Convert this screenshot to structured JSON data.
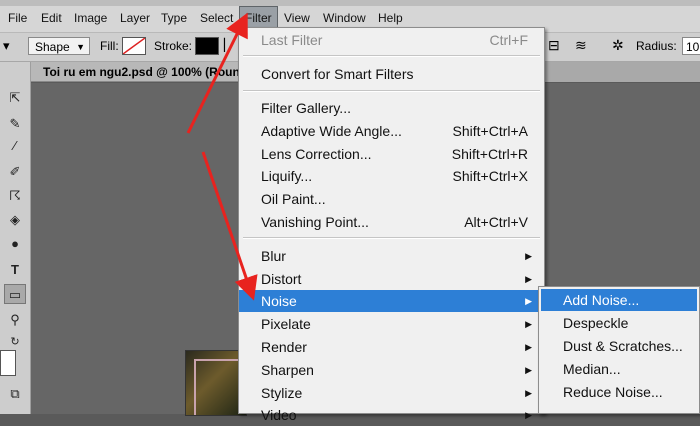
{
  "menubar": {
    "items": [
      "File",
      "Edit",
      "Image",
      "Layer",
      "Type",
      "Select",
      "Filter",
      "View",
      "Window",
      "Help"
    ],
    "active": "Filter"
  },
  "options": {
    "shape_mode": "Shape",
    "fill_label": "Fill:",
    "stroke_label": "Stroke:",
    "radius_label": "Radius:",
    "radius_value": "10"
  },
  "document": {
    "tab_title": "Toi ru em ngu2.psd @ 100% (Roun"
  },
  "filter_menu": {
    "last_filter": {
      "label": "Last Filter",
      "shortcut": "Ctrl+F"
    },
    "convert": "Convert for Smart Filters",
    "group1": [
      {
        "label": "Filter Gallery...",
        "shortcut": ""
      },
      {
        "label": "Adaptive Wide Angle...",
        "shortcut": "Shift+Ctrl+A"
      },
      {
        "label": "Lens Correction...",
        "shortcut": "Shift+Ctrl+R"
      },
      {
        "label": "Liquify...",
        "shortcut": "Shift+Ctrl+X"
      },
      {
        "label": "Oil Paint...",
        "shortcut": ""
      },
      {
        "label": "Vanishing Point...",
        "shortcut": "Alt+Ctrl+V"
      }
    ],
    "submenus": [
      "Blur",
      "Distort",
      "Noise",
      "Pixelate",
      "Render",
      "Sharpen",
      "Stylize",
      "Video"
    ],
    "highlighted": "Noise"
  },
  "noise_submenu": {
    "items": [
      "Add Noise...",
      "Despeckle",
      "Dust & Scratches...",
      "Median...",
      "Reduce Noise..."
    ],
    "highlighted": "Add Noise..."
  },
  "colors": {
    "highlight": "#2d7fd6",
    "annotation_arrow": "#e8231f"
  }
}
